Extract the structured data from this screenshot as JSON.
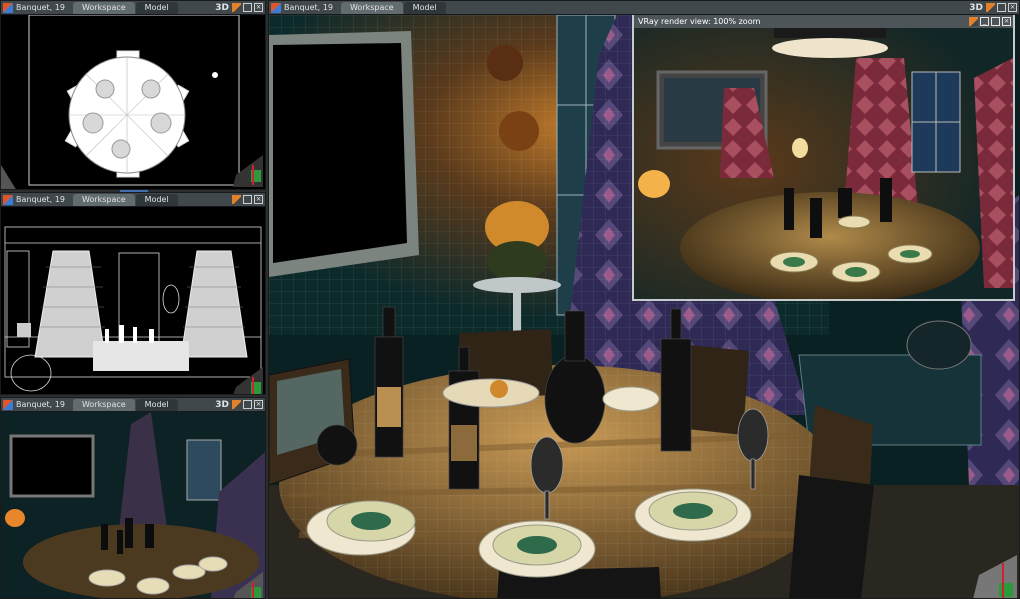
{
  "viewports": {
    "top": {
      "name": "Banquet, 19",
      "tab_active": "Workspace",
      "tab_other": "Model",
      "mode": "3D"
    },
    "front": {
      "name": "Banquet, 19",
      "tab_active": "Workspace",
      "tab_other": "Model",
      "mode": ""
    },
    "persp_small": {
      "name": "Banquet, 19",
      "tab_active": "Workspace",
      "tab_other": "Model",
      "mode": "3D"
    },
    "main": {
      "name": "Banquet, 19",
      "tab_active": "Workspace",
      "tab_other": "Model",
      "mode": "3D"
    }
  },
  "render_window": {
    "title": "VRay render view: 100% zoom"
  },
  "colors": {
    "titlebar": "#41484b",
    "active_tab": "#626b6e",
    "render_border": "#c6cbcd",
    "splitter": "#3f6fb0"
  }
}
